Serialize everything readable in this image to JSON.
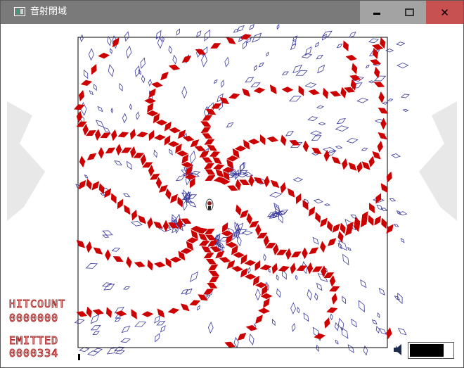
{
  "window": {
    "title": "音射閉域",
    "icon": "app-window-icon",
    "minimize_label": "",
    "maximize_label": "",
    "close_label": "✕"
  },
  "hud": {
    "hit_label": "HITCOUNT",
    "hit_value": "0000000",
    "emitted_label": "EMITTED",
    "emitted_value": "0000334",
    "volume_level": 0.8
  },
  "colors": {
    "bullet_red": "#cc0000",
    "bullet_blue": "#3b3b9e",
    "titlebar": "#7a7a7a",
    "close_button": "#c75050",
    "hud_text": "#aa2a2a"
  },
  "icons": [
    "app-window-icon",
    "minimize-icon",
    "maximize-icon",
    "close-icon",
    "speaker-icon"
  ]
}
